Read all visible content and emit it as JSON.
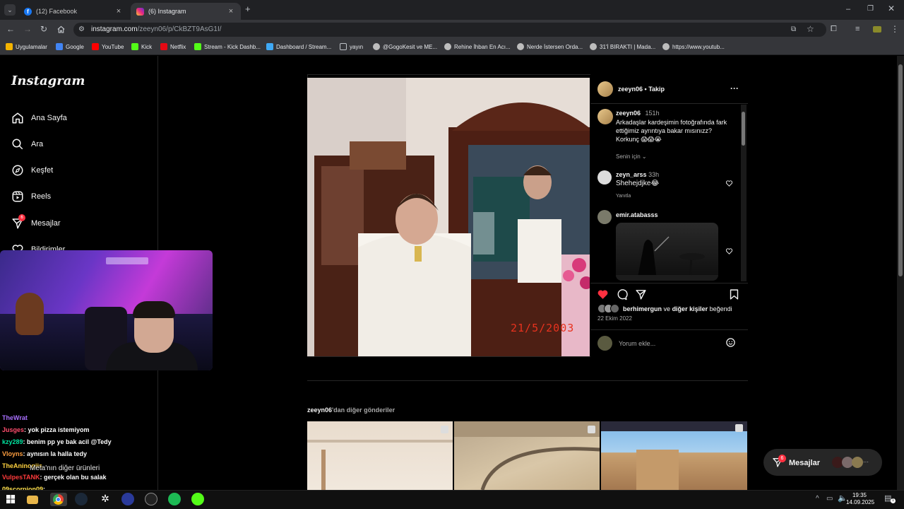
{
  "browser": {
    "tabs": [
      {
        "title": "(12) Facebook",
        "active": false,
        "icon": "facebook-icon",
        "color": "#1877f2"
      },
      {
        "title": "(6) Instagram",
        "active": true,
        "icon": "instagram-icon",
        "color": "#e1306c"
      }
    ],
    "url_host": "instagram.com",
    "url_path": "/zeeyn06/p/CkBZT9AsG1I/",
    "bookmarks": [
      {
        "label": "Uygulamalar",
        "icon": "apps-grid-icon"
      },
      {
        "label": "Google",
        "icon": "google-icon"
      },
      {
        "label": "YouTube",
        "icon": "youtube-icon"
      },
      {
        "label": "Kick",
        "icon": "kick-icon"
      },
      {
        "label": "Netflix",
        "icon": "netflix-icon"
      },
      {
        "label": "Stream - Kick Dashb...",
        "icon": "kick-icon"
      },
      {
        "label": "Dashboard / Stream...",
        "icon": "dashboard-icon"
      },
      {
        "label": "yayın",
        "icon": "folder-icon"
      },
      {
        "label": "@GogoKesit ve ME...",
        "icon": "globe-icon"
      },
      {
        "label": "Rehine İhban En Acı...",
        "icon": "globe-icon"
      },
      {
        "label": "Nerde İstersen Orda...",
        "icon": "globe-icon"
      },
      {
        "label": "31'İ BIRAKTI | Mada...",
        "icon": "globe-icon"
      },
      {
        "label": "https://www.youtub...",
        "icon": "globe-icon"
      }
    ]
  },
  "instagram": {
    "logo": "Instagram",
    "nav": [
      {
        "label": "Ana Sayfa",
        "icon": "home-icon"
      },
      {
        "label": "Ara",
        "icon": "search-icon"
      },
      {
        "label": "Keşfet",
        "icon": "compass-icon"
      },
      {
        "label": "Reels",
        "icon": "reels-icon"
      },
      {
        "label": "Mesajlar",
        "icon": "messenger-icon",
        "badge": "6"
      },
      {
        "label": "Bildirimler",
        "icon": "heart-icon"
      }
    ],
    "post": {
      "author": "zeeyn06",
      "follow_label": "Takip",
      "caption_user": "zeeyn06",
      "caption_time": "151h",
      "caption_text": "Arkadaşlar kardeşimin fotoğrafında fark ettiğimiz ayrıntıya bakar mısınızz? Korkunç 😱😱😭",
      "translate_label": "Senin için",
      "photo_date_stamp": "21/5/2003",
      "comments": [
        {
          "user": "zeyn_arss",
          "time": "33h",
          "text": "Shehejdjke😂",
          "reply_label": "Yanıtla"
        },
        {
          "user": "emir.atabasss",
          "time": "",
          "text": ""
        }
      ],
      "likes_text_user": "berhimergun",
      "likes_text_mid": "ve",
      "likes_text_others": "diğer kişiler",
      "likes_text_end": "beğendi",
      "date": "22 Ekim 2022",
      "comment_placeholder": "Yorum ekle..."
    },
    "more_posts_user": "zeeyn06",
    "more_posts_suffix": "'dan diğer gönderiler",
    "messages_pill": {
      "label": "Mesajlar",
      "badge": "6"
    }
  },
  "chat": [
    {
      "user": "TheWrat",
      "text": "",
      "color": "#a970ff"
    },
    {
      "user": "Jusges",
      "text": ": yok pizza istemiyom",
      "color": "#ff4d6d"
    },
    {
      "user": "kzy289",
      "text": ": benim pp ye bak acil @Tedy",
      "color": "#00e5a0"
    },
    {
      "user": "Vloyns",
      "text": ": aynısın la halla tedy",
      "color": "#ff9f40"
    },
    {
      "user": "TheAninogiis",
      "text": "",
      "color": "#ffd23f"
    },
    {
      "overlay": "Meta'nın diğer ürünleri"
    },
    {
      "user": "VulpesTANK",
      "text": ": gerçek olan bu salak",
      "color": "#ff3b3b"
    },
    {
      "user": "09scorpion09",
      "text": ":",
      "color": "#ffe14d"
    }
  ],
  "system": {
    "time": "19:35",
    "date": "14.09.2025"
  }
}
